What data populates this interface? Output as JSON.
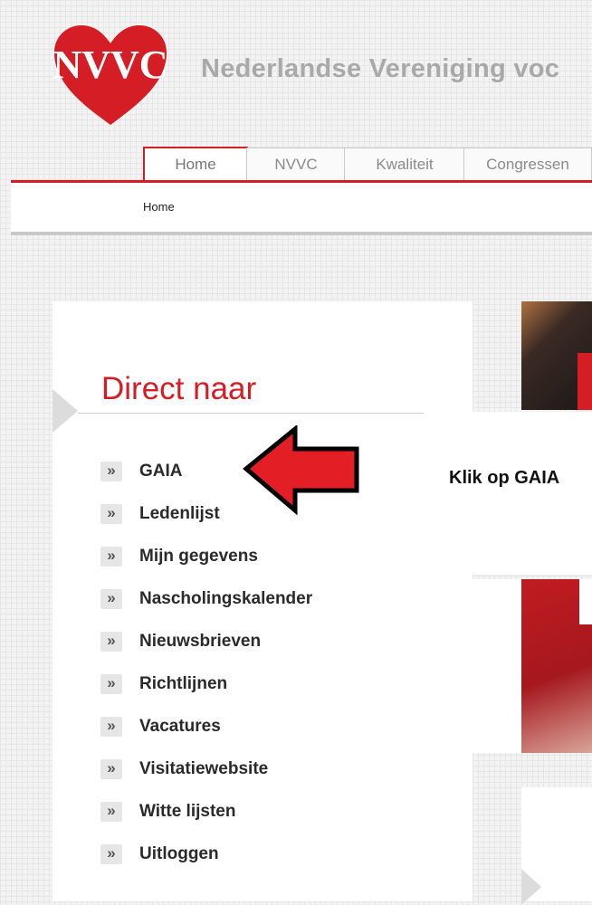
{
  "header": {
    "logo_text": "NVVC",
    "site_title": "Nederlandse Vereniging voc"
  },
  "tabs": [
    {
      "label": "Home",
      "active": true
    },
    {
      "label": "NVVC",
      "active": false
    },
    {
      "label": "Kwaliteit",
      "active": false
    },
    {
      "label": "Congressen",
      "active": false
    }
  ],
  "breadcrumb": "Home",
  "sidebar": {
    "title": "Direct naar",
    "bullet": "»",
    "items": [
      {
        "label": "GAIA"
      },
      {
        "label": "Ledenlijst"
      },
      {
        "label": "Mijn gegevens"
      },
      {
        "label": "Nascholingskalender"
      },
      {
        "label": "Nieuwsbrieven"
      },
      {
        "label": "Richtlijnen"
      },
      {
        "label": "Vacatures"
      },
      {
        "label": "Visitatiewebsite"
      },
      {
        "label": "Witte lijsten"
      },
      {
        "label": "Uitloggen"
      }
    ]
  },
  "annotation": {
    "text": "Klik op GAIA",
    "arrow_color": "#e31e24"
  },
  "colors": {
    "brand_red": "#d41d25",
    "title_gray": "#a9a9a9"
  }
}
